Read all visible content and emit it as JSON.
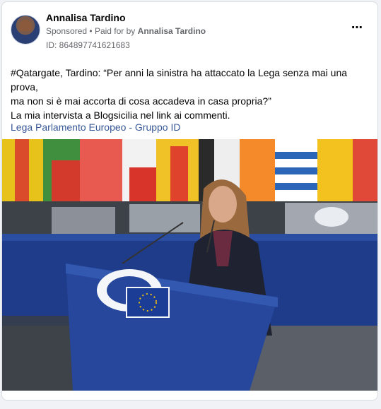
{
  "post": {
    "author": "Annalisa Tardino",
    "sponsored_label": "Sponsored",
    "paid_for_prefix": "Paid for by",
    "paid_for_name": "Annalisa Tardino",
    "separator": "•",
    "ad_id": "ID: 864897741621683",
    "more_icon": "⋯",
    "text_lines": [
      "#Qatargate, Tardino: “Per anni la sinistra ha attaccato la Lega senza mai una prova,",
      "ma non si è mai accorta di cosa accadeva in casa propria?”",
      "La mia intervista a Blogsicilia nel link ai commenti."
    ],
    "link_text": "Lega Parlamento Europeo - Gruppo ID"
  },
  "colors": {
    "link": "#385898",
    "meta": "#65676b",
    "text": "#050505"
  },
  "icons": {
    "more": "more-options-icon",
    "avatar": "profile-avatar"
  }
}
